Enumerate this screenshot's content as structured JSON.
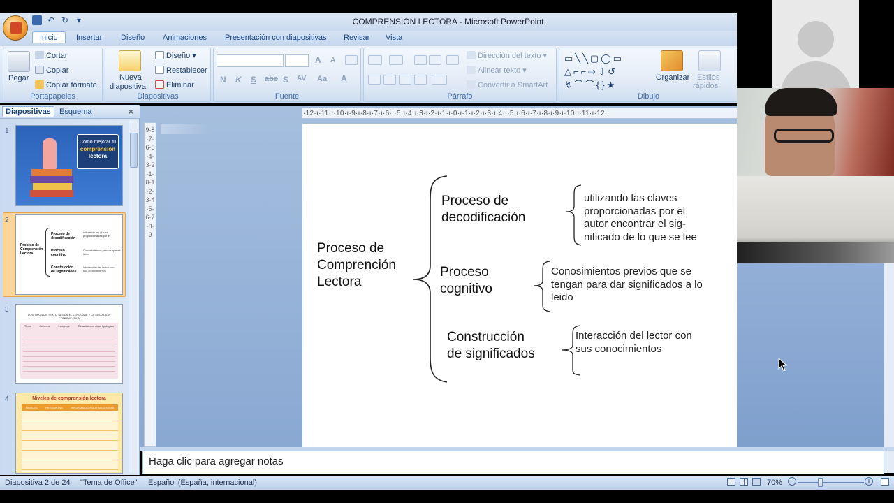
{
  "window": {
    "title": "COMPRENSION LECTORA - Microsoft PowerPoint"
  },
  "qat": {
    "save_icon": "save-icon",
    "undo_icon": "undo-icon",
    "redo_icon": "redo-icon",
    "customize_icon": "dropdown-icon"
  },
  "ribbon_tabs": [
    "Inicio",
    "Insertar",
    "Diseño",
    "Animaciones",
    "Presentación con diapositivas",
    "Revisar",
    "Vista"
  ],
  "ribbon": {
    "clipboard": {
      "label": "Portapapeles",
      "paste": "Pegar",
      "cut": "Cortar",
      "copy": "Copiar",
      "format_painter": "Copiar formato"
    },
    "slides": {
      "label": "Diapositivas",
      "new_slide_1": "Nueva",
      "new_slide_2": "diapositiva",
      "layout": "Diseño",
      "reset": "Restablecer",
      "delete": "Eliminar"
    },
    "font": {
      "label": "Fuente",
      "font_name_value": "",
      "font_size_value": "",
      "grow": "A",
      "shrink": "A",
      "bold": "N",
      "italic": "K",
      "underline": "S",
      "strike": "abe",
      "shadow": "S",
      "spacing": "AV",
      "case": "Aa",
      "color": "A"
    },
    "paragraph": {
      "label": "Párrafo",
      "text_direction": "Dirección del texto",
      "align_text": "Alinear texto",
      "smartart": "Convertir a SmartArt"
    },
    "drawing": {
      "label": "Dibujo",
      "arrange": "Organizar",
      "quick_styles_1": "Estilos",
      "quick_styles_2": "rápidos"
    }
  },
  "left_panel": {
    "tabs": [
      "Diapositivas",
      "Esquema"
    ],
    "close": "×",
    "slides": [
      {
        "number": "1",
        "title_line1": "Cómo mejorar tu",
        "title_line2": "comprensión",
        "title_line3": "lectora"
      },
      {
        "number": "2",
        "selected": true
      },
      {
        "number": "3",
        "heading": "LOS TIPOS DE TEXTO SEGÚN EL LENGUAJE Y LA SITUACIÓN COMUNICATIVA",
        "columns": [
          "Tipos",
          "Géneros",
          "Lenguaje",
          "Relación con otras tipologías"
        ]
      },
      {
        "number": "4",
        "heading": "Niveles de comprensión lectora",
        "columns": [
          "NIVELES",
          "PREGUNTAS",
          "INFORMACIÓN QUE NECESITAS"
        ]
      }
    ]
  },
  "ruler": {
    "horizontal": "·12·ı·11·ı·10·ı·9·ı·8·ı·7·ı·6·ı·5·ı·4·ı·3·ı·2·ı·1·ı·0·ı·1·ı·2·ı·3·ı·4·ı·5·ı·6·ı·7·ı·8·ı·9·ı·10·ı·11·ı·12·",
    "vertical": "9·8·7·6·5·4·3·2·1·0·1·2·3·4·5·6·7·8·9"
  },
  "slide": {
    "main_concept": [
      "Proceso de",
      "Comprención",
      "Lectora"
    ],
    "branches": [
      {
        "title": [
          "Proceso de",
          "decodificación"
        ],
        "detail": [
          "utilizando las claves",
          "proporcionadas por el",
          "autor encontrar el sig-",
          "nificado de lo que se lee"
        ]
      },
      {
        "title": [
          "Proceso",
          "cognitivo"
        ],
        "detail": [
          "Conosimientos previos que se",
          "tengan para dar significados a lo",
          "leido"
        ]
      },
      {
        "title": [
          "Construcción",
          "de significados"
        ],
        "detail": [
          "Interacción del lector con",
          "sus conocimientos"
        ]
      }
    ]
  },
  "notes": {
    "placeholder": "Haga clic para agregar notas"
  },
  "status": {
    "slide_info": "Diapositiva 2 de 24",
    "theme": "\"Tema de Office\"",
    "language": "Español (España, internacional)",
    "zoom": "70%",
    "zoom_out": "−",
    "zoom_in": "+"
  },
  "colors": {
    "ribbon_blue": "#dfe9f5",
    "accent_text": "#15428b",
    "selected_thumb": "#fbd59a",
    "canvas_bg": "#a6bfdf"
  }
}
